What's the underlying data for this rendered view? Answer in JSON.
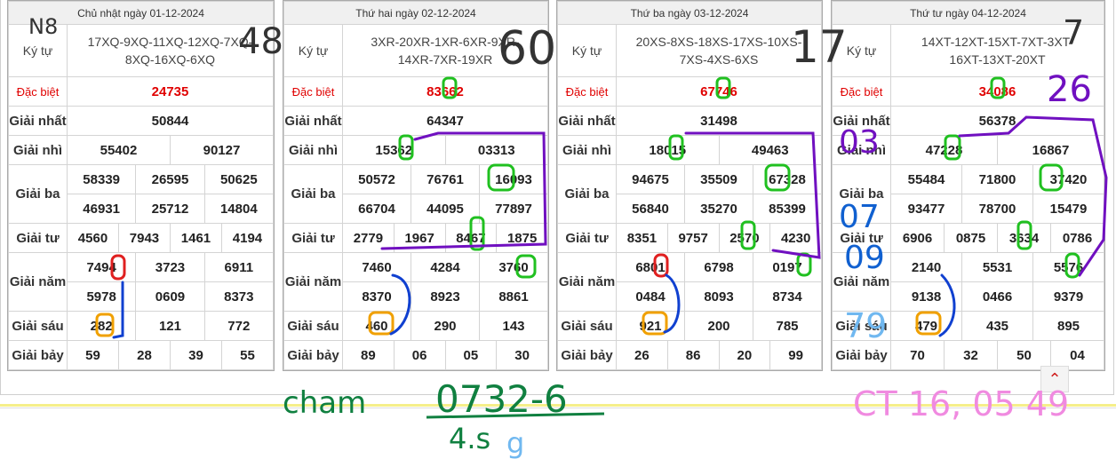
{
  "row_labels": {
    "code": "Ký tự",
    "db": "Đặc biệt",
    "g1": "Giải nhất",
    "g2": "Giải nhì",
    "g3": "Giải ba",
    "g4": "Giải tư",
    "g5": "Giải năm",
    "g6": "Giải sáu",
    "g7": "Giải bảy"
  },
  "boards": [
    {
      "title": "Chủ nhật ngày 01-12-2024",
      "code_line1": "17XQ-9XQ-11XQ-12XQ-7XQ-",
      "code_line2": "8XQ-16XQ-6XQ",
      "db": "24735",
      "g1": "50844",
      "g2": [
        "55402",
        "90127"
      ],
      "g3": [
        "58339",
        "26595",
        "50625",
        "46931",
        "25712",
        "14804"
      ],
      "g4": [
        "4560",
        "7943",
        "1461",
        "4194"
      ],
      "g5": [
        "7494",
        "3723",
        "6911",
        "5978",
        "0609",
        "8373"
      ],
      "g6": [
        "282",
        "121",
        "772"
      ],
      "g7": [
        "59",
        "28",
        "39",
        "55"
      ]
    },
    {
      "title": "Thứ hai ngày 02-12-2024",
      "code_line1": "3XR-20XR-1XR-6XR-9XR-",
      "code_line2": "14XR-7XR-19XR",
      "db": "83662",
      "g1": "64347",
      "g2": [
        "15362",
        "03313"
      ],
      "g3": [
        "50572",
        "76761",
        "16093",
        "66704",
        "44095",
        "77897"
      ],
      "g4": [
        "2779",
        "1967",
        "8467",
        "1875"
      ],
      "g5": [
        "7460",
        "4284",
        "3760",
        "8370",
        "8923",
        "8861"
      ],
      "g6": [
        "460",
        "290",
        "143"
      ],
      "g7": [
        "89",
        "06",
        "05",
        "30"
      ]
    },
    {
      "title": "Thứ ba ngày 03-12-2024",
      "code_line1": "20XS-8XS-18XS-17XS-10XS-",
      "code_line2": "7XS-4XS-6XS",
      "db": "67746",
      "g1": "31498",
      "g2": [
        "18015",
        "49463"
      ],
      "g3": [
        "94675",
        "35509",
        "67328",
        "56840",
        "35270",
        "85399"
      ],
      "g4": [
        "8351",
        "9757",
        "2570",
        "4230"
      ],
      "g5": [
        "6801",
        "6798",
        "0197",
        "0484",
        "8093",
        "8734"
      ],
      "g6": [
        "921",
        "200",
        "785"
      ],
      "g7": [
        "26",
        "86",
        "20",
        "99"
      ]
    },
    {
      "title": "Thứ tư ngày 04-12-2024",
      "code_line1": "14XT-12XT-15XT-7XT-3XT-",
      "code_line2": "16XT-13XT-20XT",
      "db": "34086",
      "g1": "56378",
      "g2": [
        "47228",
        "16867"
      ],
      "g3": [
        "55484",
        "71800",
        "37420",
        "93477",
        "78700",
        "15479"
      ],
      "g4": [
        "6906",
        "0875",
        "3634",
        "0786"
      ],
      "g5": [
        "2140",
        "5531",
        "5576",
        "9138",
        "0466",
        "9379"
      ],
      "g6": [
        "479",
        "435",
        "895"
      ],
      "g7": [
        "70",
        "32",
        "50",
        "04"
      ]
    }
  ],
  "handwriting": {
    "n8": "N8",
    "n48": "48",
    "n60": "60",
    "n17": "17",
    "n7": "7",
    "n26": "26",
    "n03": "03",
    "n07": "07",
    "n09": "09",
    "n79": "79",
    "cham": "cham",
    "formula": "0732-6",
    "sub": "4.s",
    "sub_g": "g",
    "ct": "CT 16, 05 49"
  },
  "scroll_top_icon": "chevron-up-icon"
}
